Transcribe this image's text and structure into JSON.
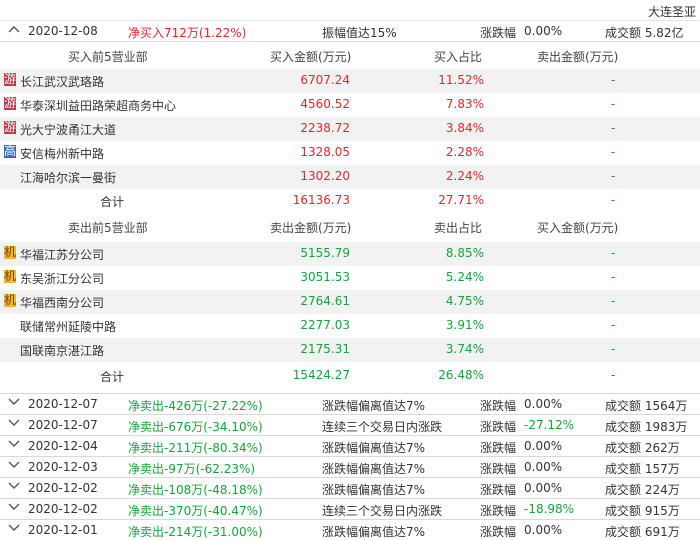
{
  "stock_name": "大连圣亚",
  "expanded": {
    "date": "2020-12-08",
    "net": "净买入712万(1.22%)",
    "reason": "振幅值达15%",
    "change_label": "涨跌幅",
    "change_value": "0.00%",
    "volume": "成交额 5.82亿"
  },
  "buy_section": {
    "headers": [
      "买入前5营业部",
      "买入金额(万元)",
      "买入占比",
      "卖出金额(万元)"
    ],
    "rows": [
      {
        "badge": "游",
        "name": "长江武汉武珞路",
        "amount": "6707.24",
        "ratio": "11.52%",
        "sell": "-"
      },
      {
        "badge": "游",
        "name": "华泰深圳益田路荣超商务中心",
        "amount": "4560.52",
        "ratio": "7.83%",
        "sell": "-"
      },
      {
        "badge": "游",
        "name": "光大宁波甬江大道",
        "amount": "2238.72",
        "ratio": "3.84%",
        "sell": "-"
      },
      {
        "badge": "高",
        "name": "安信梅州新中路",
        "amount": "1328.05",
        "ratio": "2.28%",
        "sell": "-"
      },
      {
        "badge": "",
        "name": "江海哈尔滨一曼街",
        "amount": "1302.20",
        "ratio": "2.24%",
        "sell": "-"
      }
    ],
    "total": {
      "label": "合计",
      "amount": "16136.73",
      "ratio": "27.71%",
      "sell": "-"
    }
  },
  "sell_section": {
    "headers": [
      "卖出前5营业部",
      "卖出金额(万元)",
      "卖出占比",
      "买入金额(万元)"
    ],
    "rows": [
      {
        "badge": "机",
        "name": "华福江苏分公司",
        "amount": "5155.79",
        "ratio": "8.85%",
        "buy": "-"
      },
      {
        "badge": "机",
        "name": "东吴浙江分公司",
        "amount": "3051.53",
        "ratio": "5.24%",
        "buy": "-"
      },
      {
        "badge": "机",
        "name": "华福西南分公司",
        "amount": "2764.61",
        "ratio": "4.75%",
        "buy": "-"
      },
      {
        "badge": "",
        "name": "联储常州延陵中路",
        "amount": "2277.03",
        "ratio": "3.91%",
        "buy": "-"
      },
      {
        "badge": "",
        "name": "国联南京湛江路",
        "amount": "2175.31",
        "ratio": "3.74%",
        "buy": "-"
      }
    ],
    "total": {
      "label": "合计",
      "amount": "15424.27",
      "ratio": "26.48%",
      "buy": "-"
    }
  },
  "collapsed": [
    {
      "date": "2020-12-07",
      "net": "净卖出-426万(-27.22%)",
      "reason": "涨跌幅偏离值达7%",
      "change_label": "涨跌幅",
      "change_value": "0.00%",
      "volume": "成交额 1564万",
      "change_color": "neutral"
    },
    {
      "date": "2020-12-07",
      "net": "净卖出-676万(-34.10%)",
      "reason": "连续三个交易日内涨跌",
      "change_label": "涨跌幅",
      "change_value": "-27.12%",
      "volume": "成交额 1983万",
      "change_color": "green"
    },
    {
      "date": "2020-12-04",
      "net": "净卖出-211万(-80.34%)",
      "reason": "涨跌幅偏离值达7%",
      "change_label": "涨跌幅",
      "change_value": "0.00%",
      "volume": "成交额 262万",
      "change_color": "neutral"
    },
    {
      "date": "2020-12-03",
      "net": "净卖出-97万(-62.23%)",
      "reason": "涨跌幅偏离值达7%",
      "change_label": "涨跌幅",
      "change_value": "0.00%",
      "volume": "成交额 157万",
      "change_color": "neutral"
    },
    {
      "date": "2020-12-02",
      "net": "净卖出-108万(-48.18%)",
      "reason": "涨跌幅偏离值达7%",
      "change_label": "涨跌幅",
      "change_value": "0.00%",
      "volume": "成交额 224万",
      "change_color": "neutral"
    },
    {
      "date": "2020-12-02",
      "net": "净卖出-370万(-40.47%)",
      "reason": "连续三个交易日内涨跌",
      "change_label": "涨跌幅",
      "change_value": "-18.98%",
      "volume": "成交额 915万",
      "change_color": "green"
    },
    {
      "date": "2020-12-01",
      "net": "净卖出-214万(-31.00%)",
      "reason": "涨跌幅偏离值达7%",
      "change_label": "涨跌幅",
      "change_value": "0.00%",
      "volume": "成交额 691万",
      "change_color": "neutral"
    }
  ],
  "colors": {
    "buy": "#e8262a",
    "sell": "#16a33a",
    "stripe": "#f2f2f2"
  }
}
